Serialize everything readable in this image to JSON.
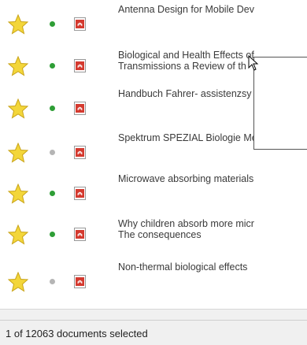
{
  "documents": [
    {
      "title": "Antenna Design for Mobile Dev",
      "status": "green"
    },
    {
      "title": "Biological and Health Effects of\nTransmissions a Review of th",
      "status": "green"
    },
    {
      "title": "Handbuch Fahrer- assistenzsy",
      "status": "green"
    },
    {
      "title": "Spektrum SPEZIAL Biologie Me",
      "status": "grey"
    },
    {
      "title": "Microwave absorbing materials",
      "status": "green"
    },
    {
      "title": "Why children absorb more micr\nThe consequences",
      "status": "green"
    },
    {
      "title": "Non-thermal biological effects",
      "status": "grey"
    }
  ],
  "status_bar": {
    "text": "1 of 12063 documents selected"
  },
  "colors": {
    "status_green": "#2e9e36",
    "status_grey": "#b5b5b5",
    "star_yellow": "#f3d63a",
    "pdf_red": "#d43a2f"
  },
  "icons": {
    "favorite": "star-icon",
    "status": "status-dot-icon",
    "file": "pdf-icon"
  }
}
